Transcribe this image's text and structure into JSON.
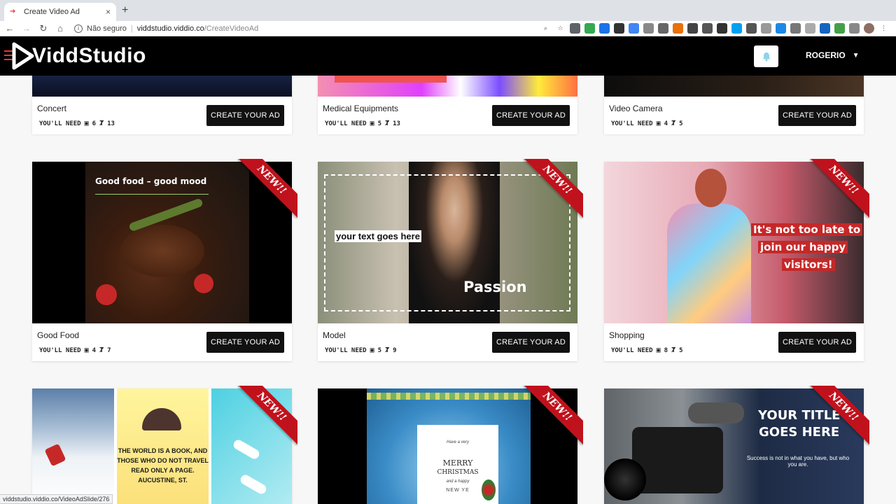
{
  "browser": {
    "tab_title": "Create Video Ad",
    "close_glyph": "×",
    "new_tab_glyph": "+",
    "security_label": "Não seguro",
    "url_host": "viddstudio.viddio.co",
    "url_path": "/CreateVideoAd",
    "status_url": "viddstudio.viddio.co/VideoAdSlide/276"
  },
  "header": {
    "brand": "ViddStudio",
    "user_name": "ROGERIO"
  },
  "badge_text": "NEW!!",
  "needs_label": "YOU'LL NEED",
  "cta_label": "CREATE YOUR AD",
  "cards": [
    {
      "title": "Concert",
      "images": "6",
      "texts": "13"
    },
    {
      "title": "Medical Equipments",
      "images": "5",
      "texts": "13"
    },
    {
      "title": "Video Camera",
      "images": "4",
      "texts": "5"
    },
    {
      "title": "Good Food",
      "images": "4",
      "texts": "7"
    },
    {
      "title": "Model",
      "images": "5",
      "texts": "9"
    },
    {
      "title": "Shopping",
      "images": "8",
      "texts": "5"
    }
  ],
  "overlays": {
    "food": "Good food – good mood",
    "model_box": "your text goes here",
    "model_word": "Passion",
    "shopping_1": "It's not too late to",
    "shopping_2": "join our happy",
    "shopping_3": "visitors!",
    "travel_1": "THE WORLD IS A BOOK, AND",
    "travel_2": "THOSE WHO DO NOT TRAVEL",
    "travel_3": "READ ONLY A PAGE.",
    "travel_4": "AUCUSTINE, ST.",
    "xmas_top": "Have a very",
    "xmas_1": "MERRY",
    "xmas_2": "CHRISTMAS",
    "xmas_3": "and a happy",
    "xmas_4": "NEW YE",
    "camera_1": "YOUR TITLE",
    "camera_2": "GOES HERE",
    "camera_sub_1": "Success is not in what you have, but who",
    "camera_sub_2": "you are."
  },
  "colors": {
    "header_bg": "#000000",
    "cta_bg": "#111111",
    "ribbon": "#c0121c",
    "accent_red": "#e53935"
  }
}
